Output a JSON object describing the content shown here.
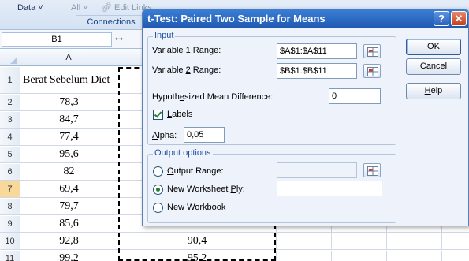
{
  "ribbon": {
    "data_label": "Data ˅",
    "all_label": "All ˅",
    "edit_links_label": "Edit Links",
    "connections_label": "Connections"
  },
  "formula_bar": {
    "name_box": "B1",
    "resize_icon": "column-resize-icon"
  },
  "sheet": {
    "col_a_header": "A",
    "rows": [
      {
        "num": "1",
        "a": "Berat Sebelum Diet",
        "b": ""
      },
      {
        "num": "2",
        "a": "78,3",
        "b": ""
      },
      {
        "num": "3",
        "a": "84,7",
        "b": ""
      },
      {
        "num": "4",
        "a": "77,4",
        "b": ""
      },
      {
        "num": "5",
        "a": "95,6",
        "b": ""
      },
      {
        "num": "6",
        "a": "82",
        "b": ""
      },
      {
        "num": "7",
        "a": "69,4",
        "b": ""
      },
      {
        "num": "8",
        "a": "79,7",
        "b": ""
      },
      {
        "num": "9",
        "a": "85,6",
        "b": ""
      },
      {
        "num": "10",
        "a": "92,8",
        "b": "90,4"
      },
      {
        "num": "11",
        "a": "99,2",
        "b": "95,2"
      }
    ]
  },
  "dialog": {
    "title": "t-Test: Paired Two Sample for Means",
    "help_symbol": "?",
    "close_symbol": "✕",
    "input_group_label": "Input",
    "var1_label": "Variable 1 Range:",
    "var1_value": "$A$1:$A$11",
    "var2_label": "Variable 2 Range:",
    "var2_value": "$B$1:$B$11",
    "hyp_label": "Hypothesized Mean Difference:",
    "hyp_value": "0",
    "labels_label": "Labels",
    "alpha_label": "Alpha:",
    "alpha_value": "0,05",
    "output_group_label": "Output options",
    "output_range_label": "Output Range:",
    "output_range_value": "",
    "new_ply_label": "New Worksheet Ply:",
    "new_ply_value": "",
    "new_workbook_label": "New Workbook",
    "ok_label": "OK",
    "cancel_label": "Cancel",
    "help_label": "Help"
  }
}
